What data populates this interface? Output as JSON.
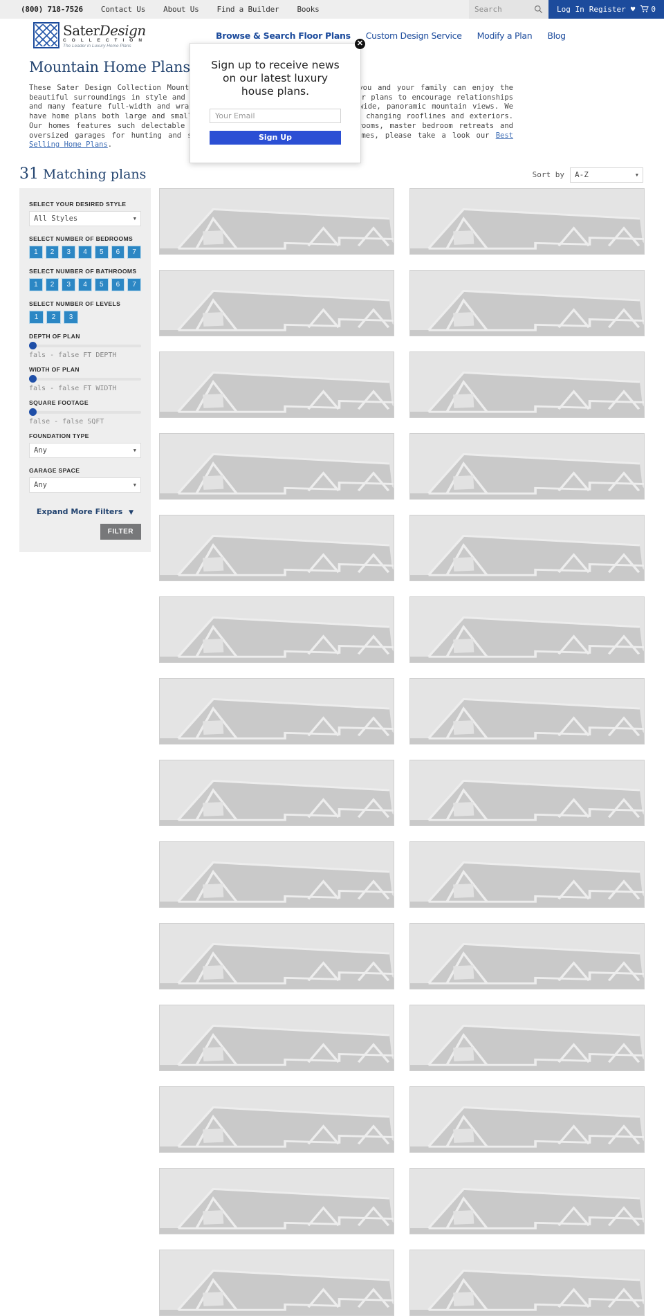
{
  "topbar": {
    "phone": "(800) 718-7526",
    "links": [
      "Contact Us",
      "About Us",
      "Find a Builder",
      "Books"
    ],
    "search_placeholder": "Search",
    "search_value": "",
    "login": "Log In",
    "register": "Register",
    "cart_count": "0"
  },
  "brand": {
    "name_left": "Sater",
    "name_right": "Design",
    "collection": "C O L L E C T I O N",
    "tagline": "The Leader in Luxury Home Plans"
  },
  "nav": {
    "items": [
      {
        "label": "Browse & Search Floor Plans",
        "active": true
      },
      {
        "label": "Custom Design Service",
        "active": false
      },
      {
        "label": "Modify a Plan",
        "active": false
      },
      {
        "label": "Blog",
        "active": false
      }
    ]
  },
  "page": {
    "title": "Mountain Home Plans",
    "description_part1": "These Sater Design Collection Mountain Home Plans are designed so that you and your family can enjoy the beautiful surroundings in style and comfort. Each house plan has open floor plans to encourage relationships and many feature full-width and wraparound porches to take advantage of wide, panoramic mountain views. We have home plans both large and small. Rustic accents of stone and wood at changing rooflines and exteriors. Our homes features such delectable spaces as gourmet kitchens, morning rooms, master bedroom retreats and oversized garages for hunting and ski storage. For more Sater Design homes, please take a look our ",
    "description_link": "Best Selling Home Plans",
    "description_part2": "."
  },
  "results": {
    "count": "31",
    "count_label": "Matching plans",
    "sort_label": "Sort by",
    "sort_value": "A-Z"
  },
  "filters": {
    "style_label": "SELECT YOUR DESIRED STYLE",
    "style_value": "All Styles",
    "bedrooms_label": "SELECT NUMBER OF BEDROOMS",
    "bedrooms_options": [
      "1",
      "2",
      "3",
      "4",
      "5",
      "6",
      "7"
    ],
    "bathrooms_label": "SELECT NUMBER OF BATHROOMS",
    "bathrooms_options": [
      "1",
      "2",
      "3",
      "4",
      "5",
      "6",
      "7"
    ],
    "levels_label": "SELECT NUMBER OF LEVELS",
    "levels_options": [
      "1",
      "2",
      "3"
    ],
    "depth_label": "DEPTH OF PLAN",
    "depth_range": "fals - false FT DEPTH",
    "width_label": "WIDTH OF PLAN",
    "width_range": "fals - false FT WIDTH",
    "sqft_label": "SQUARE FOOTAGE",
    "sqft_range": "false - false SQFT",
    "foundation_label": "FOUNDATION TYPE",
    "foundation_value": "Any",
    "garage_label": "GARAGE SPACE",
    "garage_value": "Any",
    "expand_label": "Expand More Filters",
    "expand_caret": "⌄",
    "filter_button": "FILTER"
  },
  "modal": {
    "title": "Sign up to receive news on our latest luxury house plans.",
    "email_placeholder": "Your Email",
    "email_value": "",
    "submit_label": "Sign Up",
    "close_label": "✕"
  },
  "plan_cards_count": 28,
  "colors": {
    "brand_blue": "#1c4b9c",
    "accent_blue": "#2c87c4",
    "modal_blue": "#2b4fd4",
    "heading": "#22436f",
    "filter_gray": "#77787a"
  }
}
